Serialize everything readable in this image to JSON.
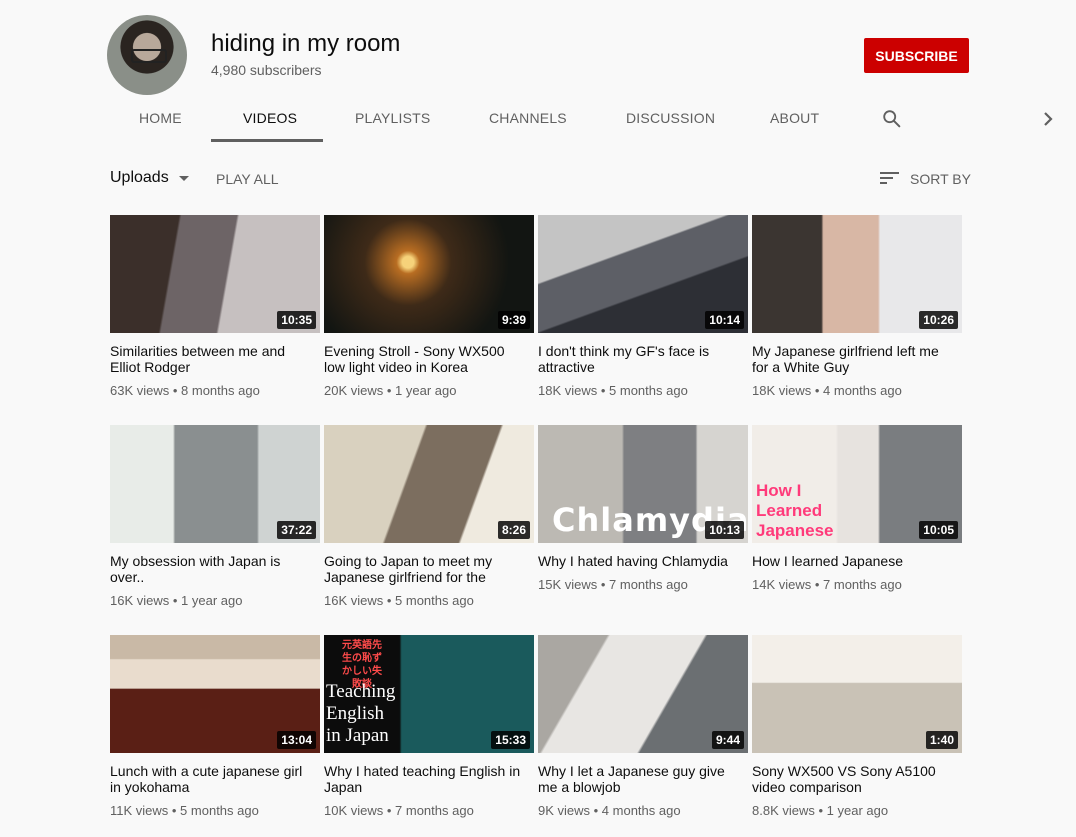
{
  "channel": {
    "name": "hiding in my room",
    "subscribers": "4,980 subscribers",
    "subscribe_label": "SUBSCRIBE"
  },
  "tabs": [
    {
      "label": "HOME"
    },
    {
      "label": "VIDEOS"
    },
    {
      "label": "PLAYLISTS"
    },
    {
      "label": "CHANNELS"
    },
    {
      "label": "DISCUSSION"
    },
    {
      "label": "ABOUT"
    }
  ],
  "icons": {
    "search": "search-icon",
    "next": "chevron-right-icon",
    "sort": "sort-icon",
    "dropdown": "caret-down-icon"
  },
  "toolbar": {
    "uploads_label": "Uploads",
    "play_all_label": "PLAY ALL",
    "sort_label": "SORT BY"
  },
  "colors": {
    "subscribe": "#cc0000",
    "background": "#f9f9f9"
  },
  "videos": [
    {
      "title": "Similarities between me and Elliot Rodger",
      "meta": "63K views • 8 months ago",
      "duration": "10:35"
    },
    {
      "title": "Evening Stroll - Sony WX500 low light video in Korea",
      "meta": "20K views • 1 year ago",
      "duration": "9:39"
    },
    {
      "title": "I don't think my GF's face is attractive",
      "meta": "18K views • 5 months ago",
      "duration": "10:14"
    },
    {
      "title": "My Japanese girlfriend left me for a White Guy",
      "meta": "18K views • 4 months ago",
      "duration": "10:26"
    },
    {
      "title": "My obsession with Japan is over..",
      "meta": "16K views • 1 year ago",
      "duration": "37:22"
    },
    {
      "title": "Going to Japan to meet my Japanese girlfriend for the",
      "meta": "16K views • 5 months ago",
      "duration": "8:26"
    },
    {
      "title": "Why I hated having Chlamydia",
      "meta": "15K views • 7 months ago",
      "duration": "10:13",
      "overlay": "Chlamydia"
    },
    {
      "title": "How I learned Japanese",
      "meta": "14K views • 7 months ago",
      "duration": "10:05",
      "overlay": "How I Learned Japanese"
    },
    {
      "title": "Lunch with a cute japanese girl in yokohama",
      "meta": "11K views • 5 months ago",
      "duration": "13:04"
    },
    {
      "title": "Why I hated teaching English in Japan",
      "meta": "10K views • 7 months ago",
      "duration": "15:33",
      "overlay": "Teaching English in Japan",
      "overlay_jp": "元英語先生の恥ずかしい失敗談"
    },
    {
      "title": "Why I let a Japanese guy give me a blowjob",
      "meta": "9K views • 4 months ago",
      "duration": "9:44"
    },
    {
      "title": "Sony WX500 VS Sony A5100 video comparison",
      "meta": "8.8K views • 1 year ago",
      "duration": "1:40"
    }
  ]
}
